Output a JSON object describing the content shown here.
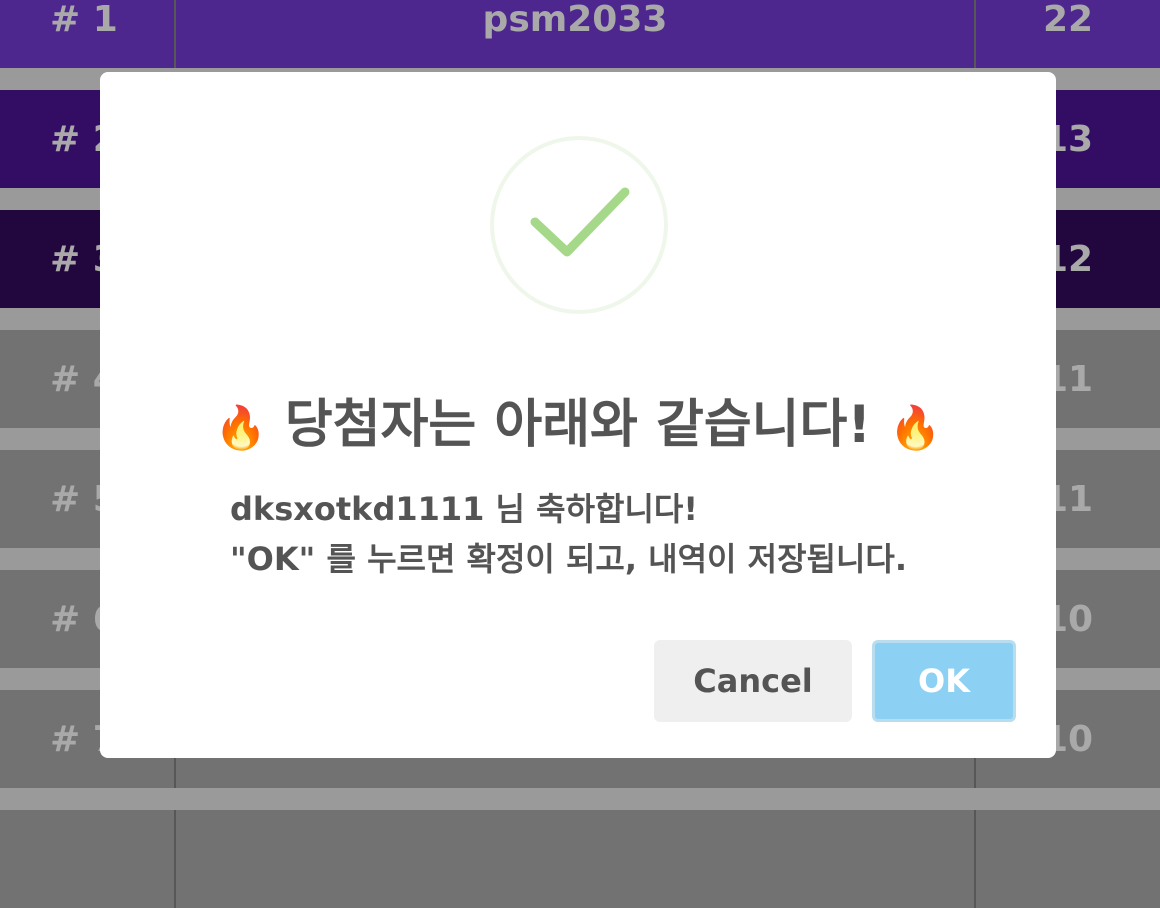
{
  "leaderboard": {
    "rows": [
      {
        "rank": "# 1",
        "name": "psm2033",
        "score": "22"
      },
      {
        "rank": "# 2",
        "name": "",
        "score": "13"
      },
      {
        "rank": "# 3",
        "name": "",
        "score": "12"
      },
      {
        "rank": "# 4",
        "name": "",
        "score": "11"
      },
      {
        "rank": "# 5",
        "name": "",
        "score": "11"
      },
      {
        "rank": "# 6",
        "name": "",
        "score": "10"
      },
      {
        "rank": "# 7",
        "name": "",
        "score": "10"
      }
    ]
  },
  "dialog": {
    "icon": "check-icon",
    "title_emoji": "🔥",
    "title": "당첨자는 아래와 같습니다!",
    "message_line1": "dksxotkd1111 님 축하합니다!",
    "message_line2": "\"OK\" 를 누르면 확정이 되고, 내역이 저장됩니다.",
    "cancel_label": "Cancel",
    "ok_label": "OK"
  },
  "colors": {
    "accent": "#8cd0f4",
    "check": "#a5d989",
    "row1": "#4e278e",
    "row2": "#330d63",
    "row3": "#22073f"
  }
}
